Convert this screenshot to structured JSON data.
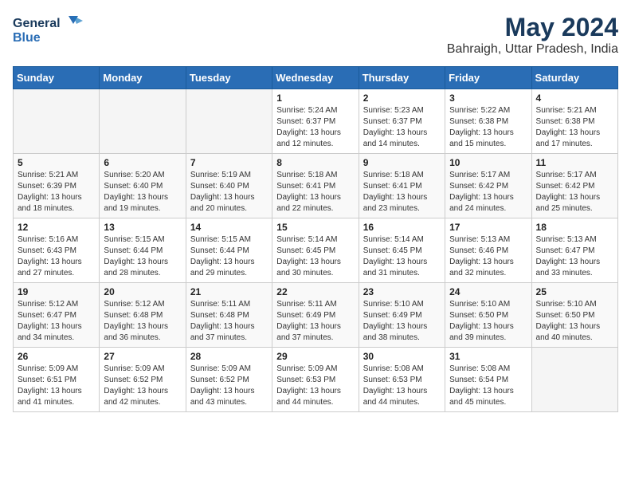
{
  "logo": {
    "line1": "General",
    "line2": "Blue"
  },
  "title": {
    "month_year": "May 2024",
    "location": "Bahraigh, Uttar Pradesh, India"
  },
  "days_of_week": [
    "Sunday",
    "Monday",
    "Tuesday",
    "Wednesday",
    "Thursday",
    "Friday",
    "Saturday"
  ],
  "weeks": [
    [
      {
        "day": "",
        "info": ""
      },
      {
        "day": "",
        "info": ""
      },
      {
        "day": "",
        "info": ""
      },
      {
        "day": "1",
        "info": "Sunrise: 5:24 AM\nSunset: 6:37 PM\nDaylight: 13 hours\nand 12 minutes."
      },
      {
        "day": "2",
        "info": "Sunrise: 5:23 AM\nSunset: 6:37 PM\nDaylight: 13 hours\nand 14 minutes."
      },
      {
        "day": "3",
        "info": "Sunrise: 5:22 AM\nSunset: 6:38 PM\nDaylight: 13 hours\nand 15 minutes."
      },
      {
        "day": "4",
        "info": "Sunrise: 5:21 AM\nSunset: 6:38 PM\nDaylight: 13 hours\nand 17 minutes."
      }
    ],
    [
      {
        "day": "5",
        "info": "Sunrise: 5:21 AM\nSunset: 6:39 PM\nDaylight: 13 hours\nand 18 minutes."
      },
      {
        "day": "6",
        "info": "Sunrise: 5:20 AM\nSunset: 6:40 PM\nDaylight: 13 hours\nand 19 minutes."
      },
      {
        "day": "7",
        "info": "Sunrise: 5:19 AM\nSunset: 6:40 PM\nDaylight: 13 hours\nand 20 minutes."
      },
      {
        "day": "8",
        "info": "Sunrise: 5:18 AM\nSunset: 6:41 PM\nDaylight: 13 hours\nand 22 minutes."
      },
      {
        "day": "9",
        "info": "Sunrise: 5:18 AM\nSunset: 6:41 PM\nDaylight: 13 hours\nand 23 minutes."
      },
      {
        "day": "10",
        "info": "Sunrise: 5:17 AM\nSunset: 6:42 PM\nDaylight: 13 hours\nand 24 minutes."
      },
      {
        "day": "11",
        "info": "Sunrise: 5:17 AM\nSunset: 6:42 PM\nDaylight: 13 hours\nand 25 minutes."
      }
    ],
    [
      {
        "day": "12",
        "info": "Sunrise: 5:16 AM\nSunset: 6:43 PM\nDaylight: 13 hours\nand 27 minutes."
      },
      {
        "day": "13",
        "info": "Sunrise: 5:15 AM\nSunset: 6:44 PM\nDaylight: 13 hours\nand 28 minutes."
      },
      {
        "day": "14",
        "info": "Sunrise: 5:15 AM\nSunset: 6:44 PM\nDaylight: 13 hours\nand 29 minutes."
      },
      {
        "day": "15",
        "info": "Sunrise: 5:14 AM\nSunset: 6:45 PM\nDaylight: 13 hours\nand 30 minutes."
      },
      {
        "day": "16",
        "info": "Sunrise: 5:14 AM\nSunset: 6:45 PM\nDaylight: 13 hours\nand 31 minutes."
      },
      {
        "day": "17",
        "info": "Sunrise: 5:13 AM\nSunset: 6:46 PM\nDaylight: 13 hours\nand 32 minutes."
      },
      {
        "day": "18",
        "info": "Sunrise: 5:13 AM\nSunset: 6:47 PM\nDaylight: 13 hours\nand 33 minutes."
      }
    ],
    [
      {
        "day": "19",
        "info": "Sunrise: 5:12 AM\nSunset: 6:47 PM\nDaylight: 13 hours\nand 34 minutes."
      },
      {
        "day": "20",
        "info": "Sunrise: 5:12 AM\nSunset: 6:48 PM\nDaylight: 13 hours\nand 36 minutes."
      },
      {
        "day": "21",
        "info": "Sunrise: 5:11 AM\nSunset: 6:48 PM\nDaylight: 13 hours\nand 37 minutes."
      },
      {
        "day": "22",
        "info": "Sunrise: 5:11 AM\nSunset: 6:49 PM\nDaylight: 13 hours\nand 37 minutes."
      },
      {
        "day": "23",
        "info": "Sunrise: 5:10 AM\nSunset: 6:49 PM\nDaylight: 13 hours\nand 38 minutes."
      },
      {
        "day": "24",
        "info": "Sunrise: 5:10 AM\nSunset: 6:50 PM\nDaylight: 13 hours\nand 39 minutes."
      },
      {
        "day": "25",
        "info": "Sunrise: 5:10 AM\nSunset: 6:50 PM\nDaylight: 13 hours\nand 40 minutes."
      }
    ],
    [
      {
        "day": "26",
        "info": "Sunrise: 5:09 AM\nSunset: 6:51 PM\nDaylight: 13 hours\nand 41 minutes."
      },
      {
        "day": "27",
        "info": "Sunrise: 5:09 AM\nSunset: 6:52 PM\nDaylight: 13 hours\nand 42 minutes."
      },
      {
        "day": "28",
        "info": "Sunrise: 5:09 AM\nSunset: 6:52 PM\nDaylight: 13 hours\nand 43 minutes."
      },
      {
        "day": "29",
        "info": "Sunrise: 5:09 AM\nSunset: 6:53 PM\nDaylight: 13 hours\nand 44 minutes."
      },
      {
        "day": "30",
        "info": "Sunrise: 5:08 AM\nSunset: 6:53 PM\nDaylight: 13 hours\nand 44 minutes."
      },
      {
        "day": "31",
        "info": "Sunrise: 5:08 AM\nSunset: 6:54 PM\nDaylight: 13 hours\nand 45 minutes."
      },
      {
        "day": "",
        "info": ""
      }
    ]
  ]
}
